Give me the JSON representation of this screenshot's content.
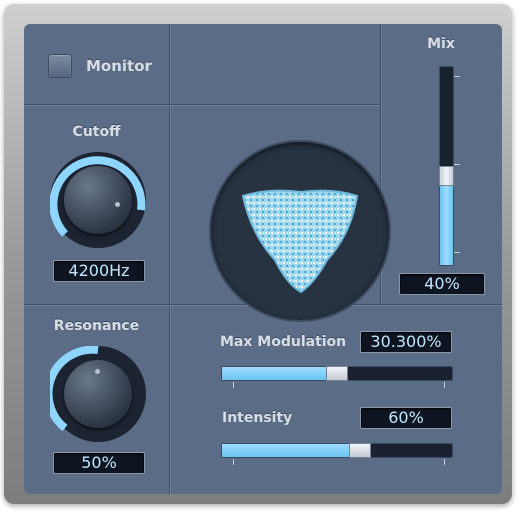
{
  "monitor": {
    "label": "Monitor"
  },
  "mix": {
    "label": "Mix",
    "value": "40%",
    "fraction": 0.4
  },
  "cutoff": {
    "label": "Cutoff",
    "value": "4200Hz"
  },
  "resonance": {
    "label": "Resonance",
    "value": "50%"
  },
  "max_modulation": {
    "label": "Max Modulation",
    "value": "30.300%",
    "fraction": 0.5
  },
  "intensity": {
    "label": "Intensity",
    "value": "60%",
    "fraction": 0.6
  },
  "colors": {
    "accent": "#7cd0ff",
    "panel": "#5b6d86",
    "display_bg": "#0e1520"
  }
}
